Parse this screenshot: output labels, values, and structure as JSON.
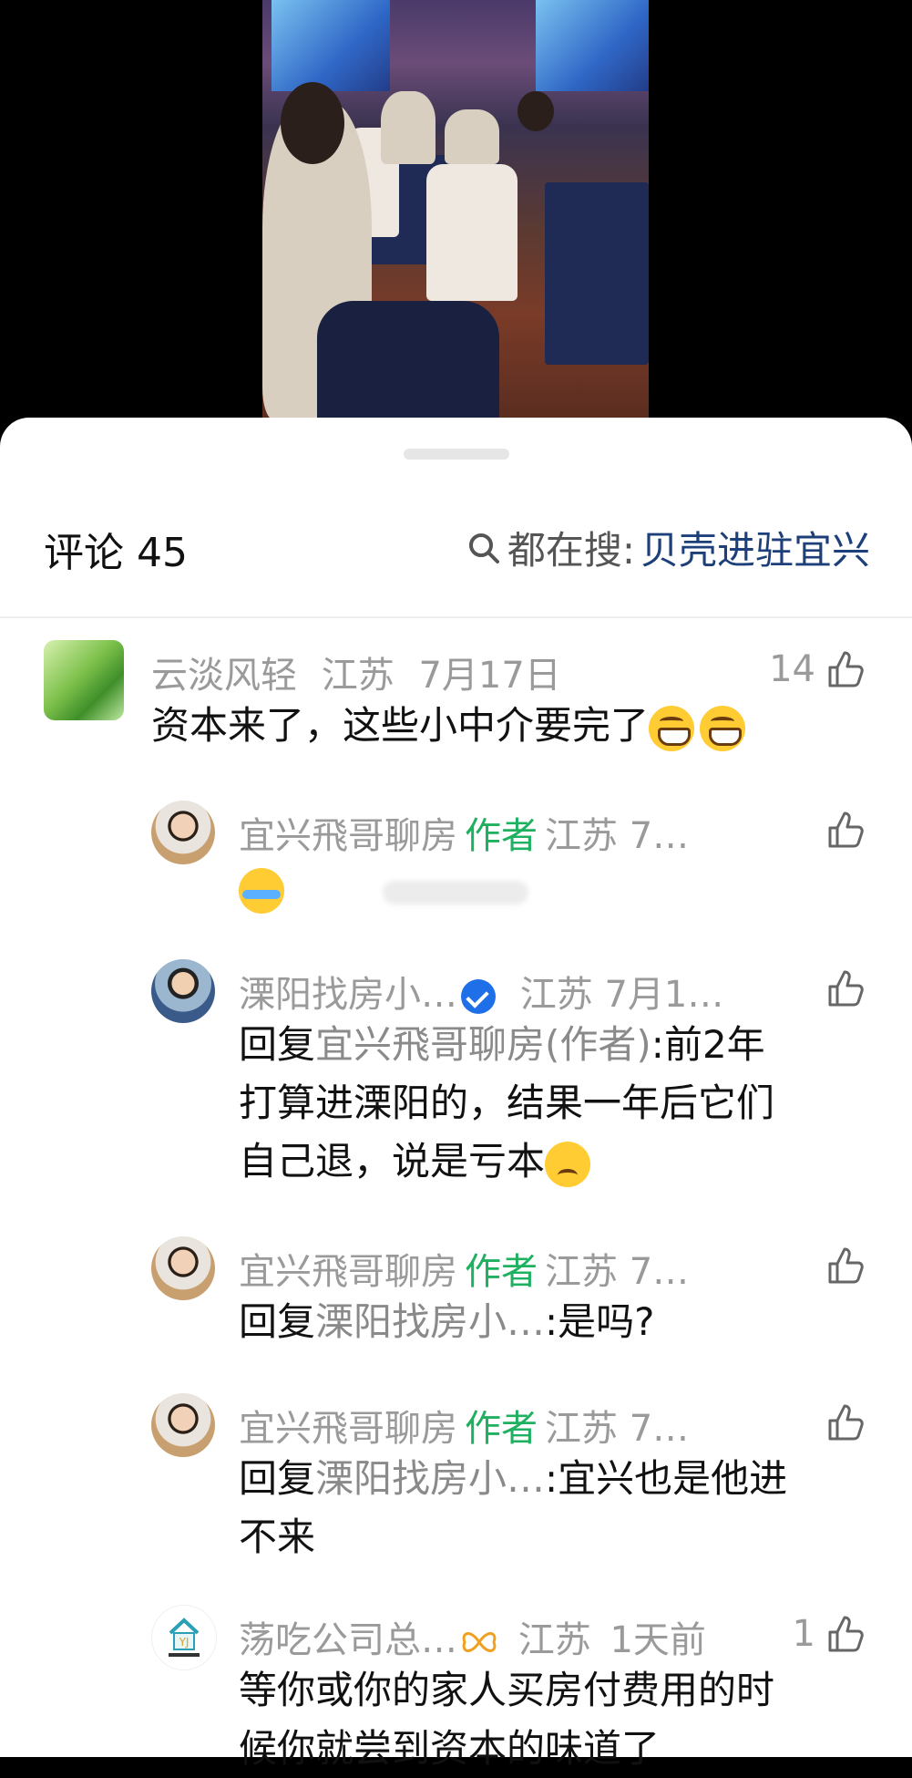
{
  "header": {
    "title": "评论 45",
    "search_label": "都在搜:",
    "search_term": "贝壳进驻宜兴"
  },
  "comments": [
    {
      "user": "云淡风轻",
      "location": "江苏",
      "time": "7月17日",
      "text": "资本来了，这些小中介要完了",
      "likes": "14"
    },
    {
      "user": "宜兴飛哥聊房",
      "author_tag": "作者",
      "location": "江苏",
      "time": "7…",
      "text": ""
    },
    {
      "user": "溧阳找房小…",
      "location": "江苏",
      "time": "7月1…",
      "reply_prefix": "回复",
      "reply_to": "宜兴飛哥聊房(作者)",
      "text_line1": ":前2年",
      "text_line2": "打算进溧阳的，结果一年后它们",
      "text_line3": "自己退，说是亏本"
    },
    {
      "user": "宜兴飛哥聊房",
      "author_tag": "作者",
      "location": "江苏",
      "time": "7…",
      "reply_prefix": "回复",
      "reply_to": "溧阳找房小…",
      "text": ":是吗?"
    },
    {
      "user": "宜兴飛哥聊房",
      "author_tag": "作者",
      "location": "江苏",
      "time": "7…",
      "reply_prefix": "回复",
      "reply_to": "溧阳找房小…",
      "text_line1": ":宜兴也是他进",
      "text_line2": "不来"
    },
    {
      "user": "荡吃公司总…",
      "location": "江苏",
      "time": "1天前",
      "likes": "1",
      "text_line1": "等你或你的家人买房付费用的时",
      "text_line2": "候你就尝到资本的味道了"
    }
  ],
  "colors": {
    "author_tag": "#1fb060",
    "search_term": "#1d3f7a",
    "meta_gray": "#9a9a9a"
  },
  "icons": [
    "search-icon",
    "thumbs-up-icon",
    "verified-icon",
    "bow-icon"
  ]
}
